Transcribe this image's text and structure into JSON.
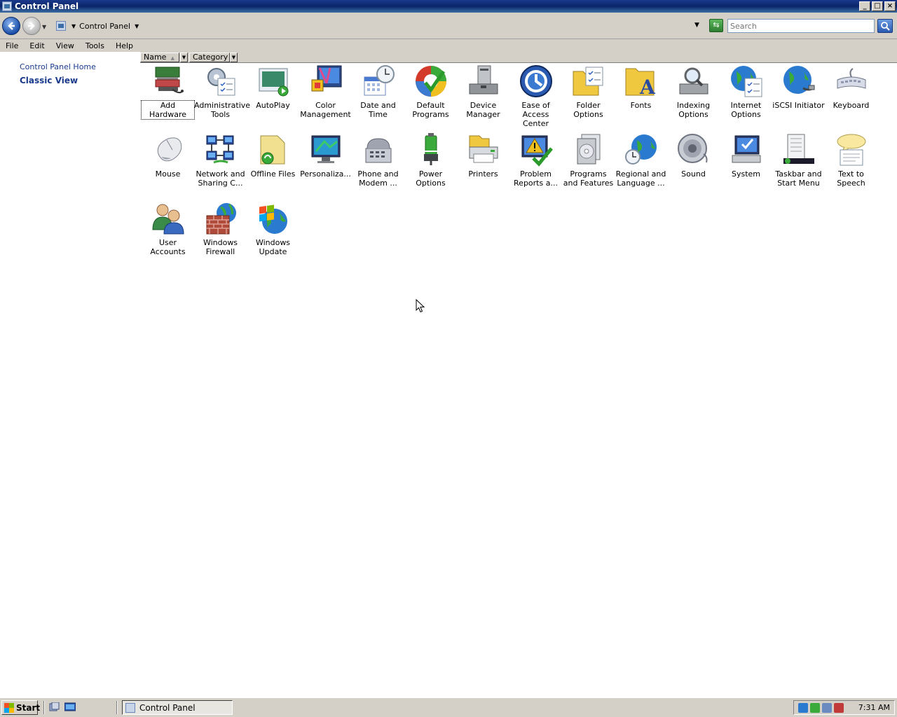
{
  "window": {
    "title": "Control Panel"
  },
  "address": {
    "location": "Control Panel",
    "search_placeholder": "Search"
  },
  "menu": [
    "File",
    "Edit",
    "View",
    "Tools",
    "Help"
  ],
  "left_pane": {
    "home_link": "Control Panel Home",
    "classic_view": "Classic View"
  },
  "columns": {
    "name": "Name",
    "category": "Category"
  },
  "items": [
    "Add Hardware",
    "Administrative Tools",
    "AutoPlay",
    "Color Management",
    "Date and Time",
    "Default Programs",
    "Device Manager",
    "Ease of Access Center",
    "Folder Options",
    "Fonts",
    "Indexing Options",
    "Internet Options",
    "iSCSI Initiator",
    "Keyboard",
    "Mouse",
    "Network and Sharing C...",
    "Offline Files",
    "Personaliza...",
    "Phone and Modem ...",
    "Power Options",
    "Printers",
    "Problem Reports a...",
    "Programs and Features",
    "Regional and Language ...",
    "Sound",
    "System",
    "Taskbar and Start Menu",
    "Text to Speech",
    "User Accounts",
    "Windows Firewall",
    "Windows Update"
  ],
  "taskbar": {
    "start": "Start",
    "task": "Control Panel",
    "clock": "7:31 AM"
  }
}
